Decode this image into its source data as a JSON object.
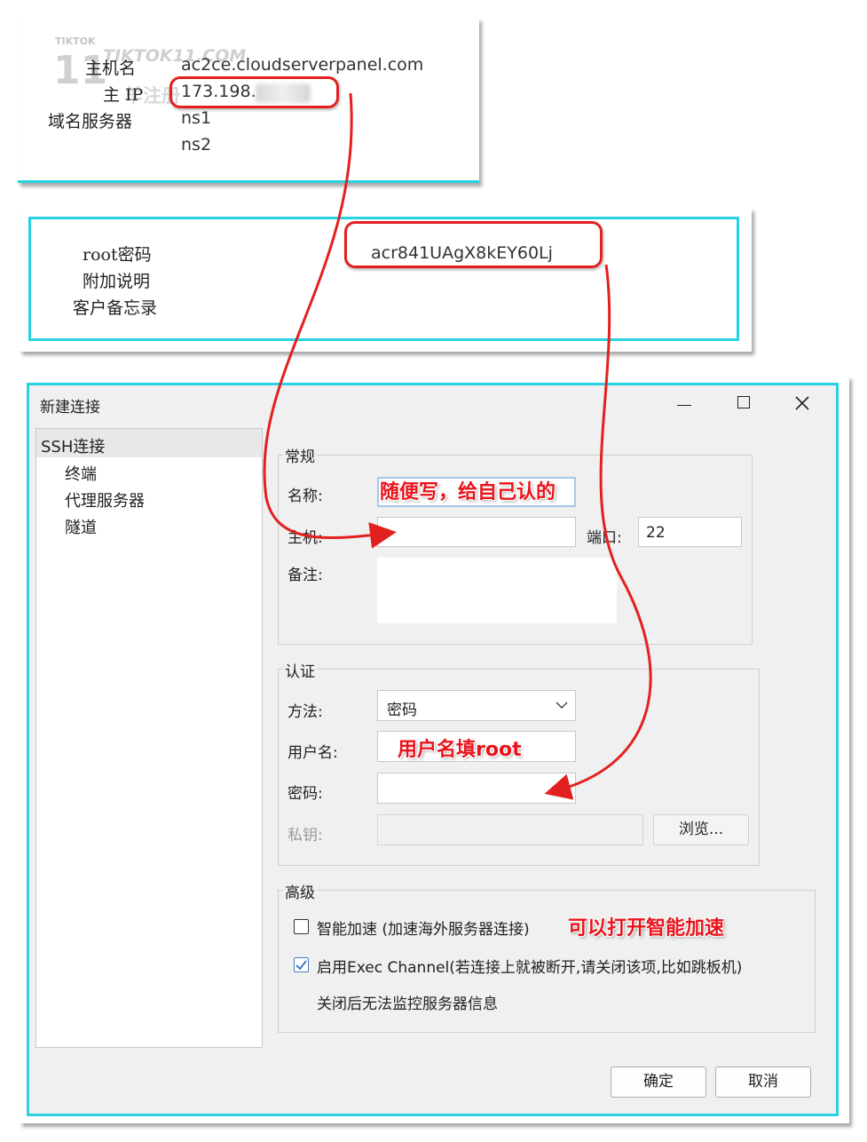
{
  "server_info": {
    "watermark_top": "TIKTOK",
    "watermark_site": "TIKTOK11.COM",
    "watermark_logo": "11",
    "watermark_cn": "羊注册",
    "rows": [
      {
        "label": "主机名",
        "value": "ac2ce.cloudserverpanel.com"
      },
      {
        "label": "主 IP",
        "value": "173.198."
      },
      {
        "label": "域名服务器",
        "value": "ns1"
      },
      {
        "label": "",
        "value": "ns2"
      }
    ]
  },
  "credentials": {
    "root_label": "root密码",
    "root_value": "acr841UAgX8kEY60Lj",
    "extra_label": "附加说明",
    "memo_label": "客户备忘录"
  },
  "dialog": {
    "title": "新建连接",
    "window_controls": [
      "minimize-icon",
      "maximize-icon",
      "close-icon"
    ],
    "tree": {
      "root": "SSH连接",
      "children": [
        "终端",
        "代理服务器",
        "隧道"
      ]
    },
    "general": {
      "title": "常规",
      "name_label": "名称:",
      "host_label": "主机:",
      "port_label": "端口:",
      "port_value": "22",
      "note_label": "备注:"
    },
    "auth": {
      "title": "认证",
      "method_label": "方法:",
      "method_value": "密码",
      "username_label": "用户名:",
      "password_label": "密码:",
      "privkey_label": "私钥:",
      "browse_label": "浏览..."
    },
    "advanced": {
      "title": "高级",
      "smart_accel_label": "智能加速 (加速海外服务器连接)",
      "smart_accel_checked": false,
      "exec_channel_label": "启用Exec Channel(若连接上就被断开,请关闭该项,比如跳板机)",
      "exec_channel_checked": true,
      "exec_note": "关闭后无法监控服务器信息"
    },
    "ok_label": "确定",
    "cancel_label": "取消"
  },
  "annotations": {
    "name_hint": "随便写，给自己认的",
    "username_hint": "用户名填root",
    "accel_hint": "可以打开智能加速",
    "color": "#e8141c"
  }
}
